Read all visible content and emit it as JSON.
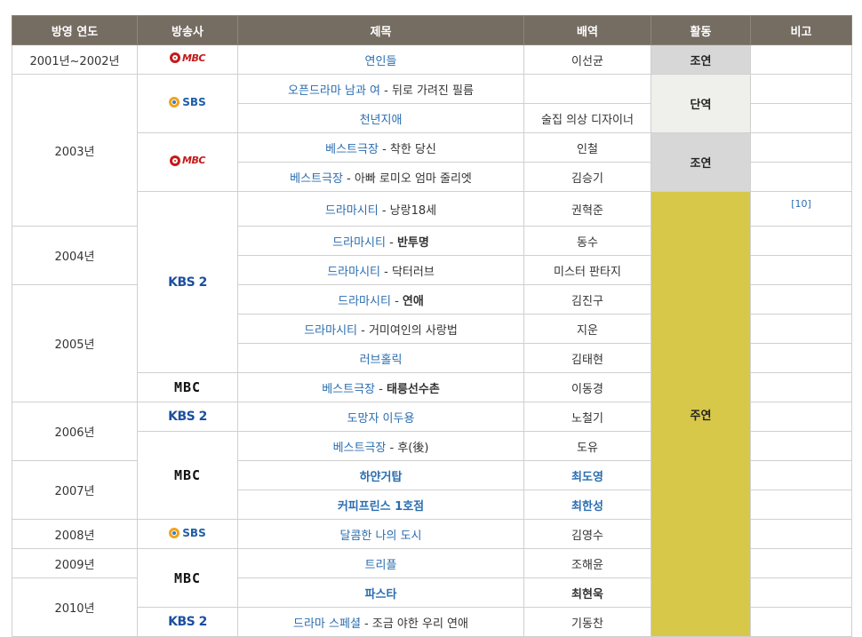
{
  "headers": {
    "year": "방영 연도",
    "broadcaster": "방송사",
    "title": "제목",
    "role": "배역",
    "activity": "활동",
    "note": "비고"
  },
  "logos": {
    "mbc_old": "MBC",
    "sbs": "SBS",
    "kbs2": "KBS 2",
    "mbc_new": "MBC"
  },
  "years": {
    "y2001": "2001년~2002년",
    "y2003": "2003년",
    "y2004": "2004년",
    "y2005": "2005년",
    "y2006": "2006년",
    "y2007": "2007년",
    "y2008": "2008년",
    "y2009": "2009년",
    "y2010": "2010년"
  },
  "activities": {
    "supporting": "조연",
    "special": "단역",
    "lead": "주연"
  },
  "rows": [
    {
      "prefix": "연인들",
      "suffix": "",
      "role": "이선균"
    },
    {
      "prefix": "오픈드라마 남과 여",
      "suffix": " - 뒤로 가려진 필름",
      "role": ""
    },
    {
      "prefix": "천년지애",
      "suffix": "",
      "role": "술집 의상 디자이너"
    },
    {
      "prefix": "베스트극장",
      "suffix": " - 착한 당신",
      "role": "인철"
    },
    {
      "prefix": "베스트극장",
      "suffix": " - 아빠 로미오 엄마 줄리엣",
      "role": "김승기"
    },
    {
      "prefix": "드라마시티",
      "suffix": " - 낭랑18세",
      "role": "권혁준",
      "note": "[10]"
    },
    {
      "prefix": "드라마시티",
      "suffix_sep": " - ",
      "suffix_bold": "반투명",
      "role": "동수"
    },
    {
      "prefix": "드라마시티",
      "suffix": " - 닥터러브",
      "role": "미스터 판타지"
    },
    {
      "prefix": "드라마시티",
      "suffix_sep": " - ",
      "suffix_bold": "연애",
      "role": "김진구"
    },
    {
      "prefix": "드라마시티",
      "suffix": " - 거미여인의 사랑법",
      "role": "지운"
    },
    {
      "prefix": "러브홀릭",
      "suffix": "",
      "role": "김태현"
    },
    {
      "prefix": "베스트극장",
      "suffix_sep": " - ",
      "suffix_bold": "태릉선수촌",
      "role": "이동경"
    },
    {
      "prefix": "도망자 이두용",
      "suffix": "",
      "role": "노철기"
    },
    {
      "prefix": "베스트극장",
      "suffix": " - 후(後)",
      "role": "도유"
    },
    {
      "prefix": "하얀거탑",
      "suffix": "",
      "role": "최도영"
    },
    {
      "prefix": "커피프린스 1호점",
      "suffix": "",
      "role": "최한성"
    },
    {
      "prefix": "달콤한 나의 도시",
      "suffix": "",
      "role": "김영수"
    },
    {
      "prefix": "트리플",
      "suffix": "",
      "role": "조해윤"
    },
    {
      "prefix": "파스타",
      "suffix": "",
      "role": "최현욱"
    },
    {
      "prefix": "드라마 스페셜",
      "suffix": " - 조금 야한 우리 연애",
      "role": "기동찬"
    }
  ]
}
